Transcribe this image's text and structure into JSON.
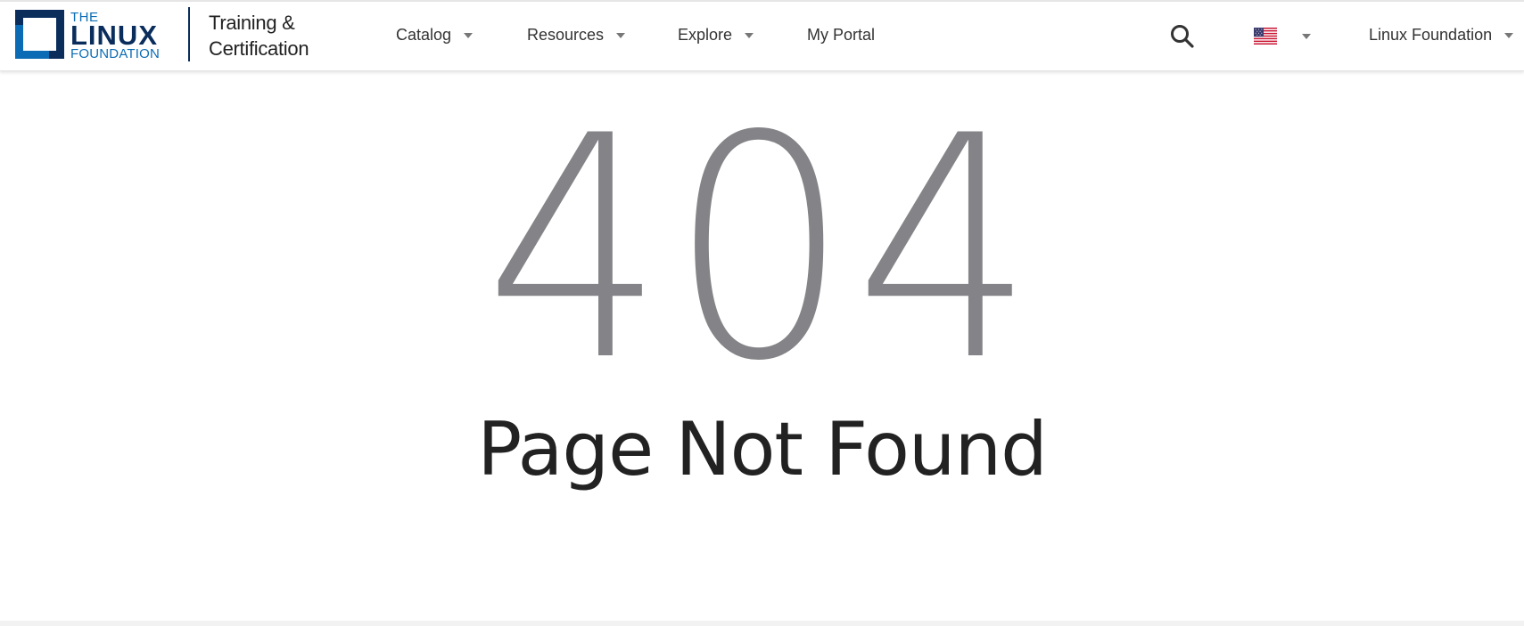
{
  "header": {
    "logo": {
      "line1": "THE",
      "line2": "LINUX",
      "line3": "FOUNDATION"
    },
    "site_title": {
      "line1": "Training &",
      "line2": "Certification"
    },
    "nav": [
      {
        "label": "Catalog",
        "has_dropdown": true
      },
      {
        "label": "Resources",
        "has_dropdown": true
      },
      {
        "label": "Explore",
        "has_dropdown": true
      },
      {
        "label": "My Portal",
        "has_dropdown": false
      }
    ],
    "search_icon": "search-icon",
    "language_icon": "us-flag-icon",
    "account_label": "Linux Foundation"
  },
  "main": {
    "error_code": "404",
    "error_message": "Page Not Found"
  },
  "colors": {
    "brand_navy": "#0a2d5c",
    "brand_blue": "#0b6cb5",
    "error_code": "#848488",
    "text": "#333333"
  }
}
